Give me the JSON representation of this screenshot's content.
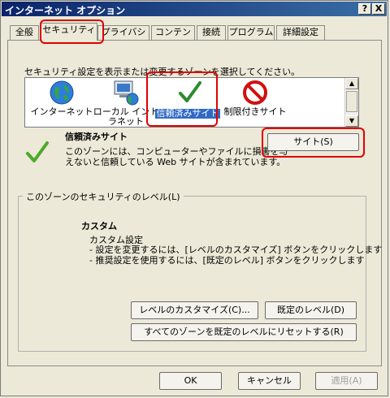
{
  "window": {
    "title": "インターネット オプション",
    "help_button": "?",
    "close_button": "X"
  },
  "tabs": [
    {
      "label": "全般"
    },
    {
      "label": "セキュリティ"
    },
    {
      "label": "プライバシー"
    },
    {
      "label": "コンテンツ"
    },
    {
      "label": "接続"
    },
    {
      "label": "プログラム"
    },
    {
      "label": "詳細設定"
    }
  ],
  "security": {
    "instruction": "セキュリティ設定を表示または変更するゾーンを選択してください。",
    "zones": [
      {
        "label": "インターネット",
        "icon": "globe-icon"
      },
      {
        "label": "ローカル イントラネット",
        "icon": "intranet-icon"
      },
      {
        "label": "信頼済みサイト",
        "icon": "check-icon",
        "selected": true
      },
      {
        "label": "制限付きサイト",
        "icon": "restricted-icon"
      }
    ],
    "selected_zone": {
      "name": "信頼済みサイト",
      "desc_line1": "このゾーンには、コンピューターやファイルに損害を与",
      "desc_line2": "えないと信頼している Web サイトが含まれています。"
    },
    "sites_button": "サイト(S)",
    "level_group": {
      "legend": "このゾーンのセキュリティのレベル(L)",
      "level_name": "カスタム",
      "custom_title": "カスタム設定",
      "bullet1": "- 設定を変更するには、[レベルのカスタマイズ] ボタンをクリックします",
      "bullet2": "- 推奨設定を使用するには、[既定のレベル] ボタンをクリックします",
      "customize_button": "レベルのカスタマイズ(C)...",
      "default_button": "既定のレベル(D)"
    },
    "reset_all_button": "すべてのゾーンを既定のレベルにリセットする(R)"
  },
  "footer": {
    "ok": "OK",
    "cancel": "キャンセル",
    "apply": "適用(A)"
  }
}
